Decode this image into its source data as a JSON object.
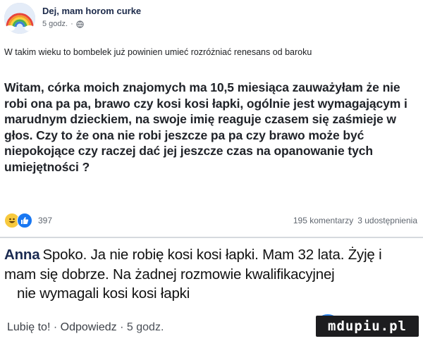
{
  "post": {
    "author": "Dej, mam horom curke",
    "time": "5 godz.",
    "privacy_icon": "globe-icon",
    "intro_text": "W takim wieku to bombelek już powinien umieć rozróżniać renesans od baroku",
    "big_text": "Witam, córka moich znajomych ma 10,5 miesiąca zauważyłam że nie robi ona pa pa, brawo czy kosi kosi łapki, ogólnie jest wymagającym i marudnym dzieckiem, na swoje imię reaguje czasem się zaśmieje w głos. Czy to że ona nie robi jeszcze pa pa czy brawo może być niepokojące czy raczej dać jej jeszcze czas na opanowanie tych umiejętności ?",
    "reactions": {
      "count": "397",
      "icons": [
        "haha-reaction-icon",
        "like-reaction-icon"
      ]
    },
    "comments_count": "195 komentarzy",
    "shares_count": "3 udostępnienia"
  },
  "comment": {
    "name": "Anna",
    "lines": [
      "Spoko. Ja nie robię kosi kosi łapki. Mam 32 lata. Żyję i",
      "mam się dobrze. Na żadnej rozmowie kwalifikacyjnej",
      "  nie wymagali kosi kosi łapki"
    ],
    "like_label": "Lubię to!",
    "reply_label": "Odpowiedz",
    "time": "5 godz."
  },
  "watermark": "mdupiu.pl",
  "colors": {
    "like_blue": "#1877f2",
    "haha_yellow": "#f7c93e",
    "meta_gray": "#606770"
  }
}
